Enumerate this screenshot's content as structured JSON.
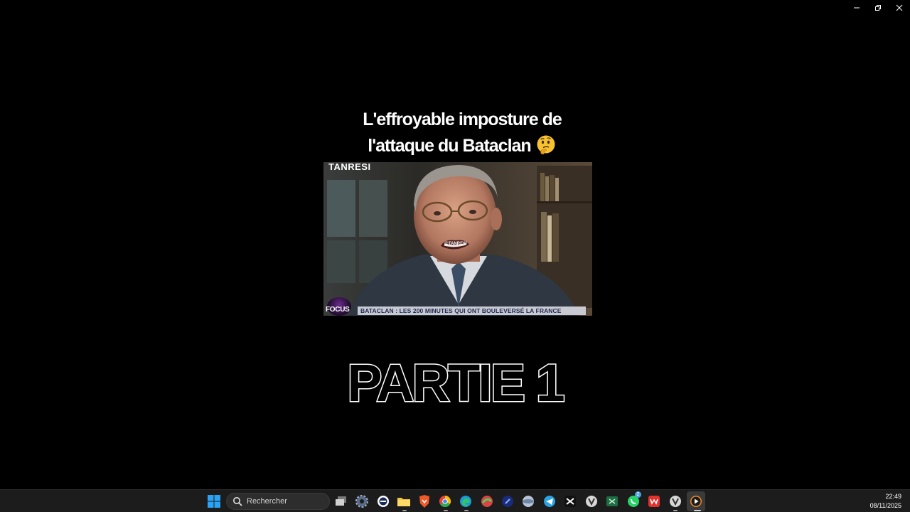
{
  "window": {
    "controls": [
      "minimize-icon",
      "restore-icon",
      "close-icon"
    ]
  },
  "video": {
    "overlay_title_line1": "L'effroyable imposture de",
    "overlay_title_line2": "l'attaque du  Bataclan",
    "overlay_emoji": "thinking-face-emoji",
    "channel_tag": "TANRESI",
    "watermark": "@TANRESI",
    "focus_logo": "FOCUS",
    "banner_text": "BATACLAN : LES 200 MINUTES QUI ONT BOULEVERSÉ LA FRANCE",
    "caption": "PARTIE 1"
  },
  "taskbar": {
    "search_placeholder": "Rechercher",
    "apps": [
      "windows-start-icon",
      "task-view-icon",
      "settings-icon",
      "app-icon",
      "file-explorer-icon",
      "brave-icon",
      "chrome-icon",
      "edge-icon",
      "app-icon-2",
      "app-icon-3",
      "app-icon-4",
      "telegram-icon",
      "capcut-icon",
      "vivaldi-icon",
      "excel-icon",
      "whatsapp-icon",
      "wps-icon",
      "vivaldi-icon-2",
      "media-player-icon"
    ],
    "whatsapp_badge": "2",
    "time": "22:49",
    "date": "08/11/2025"
  },
  "colors": {
    "background": "#000000",
    "taskbar": "#1c1c1c",
    "banner": "#c9c9d2",
    "banner_text": "#1d2a52"
  }
}
